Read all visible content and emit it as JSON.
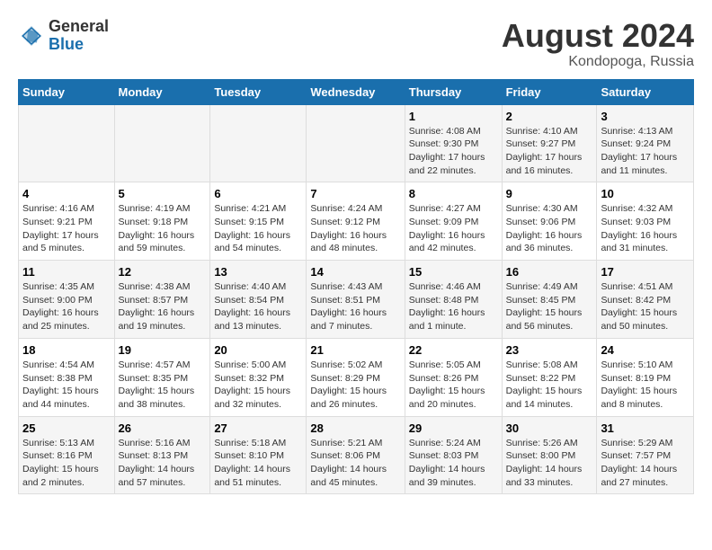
{
  "logo": {
    "general": "General",
    "blue": "Blue"
  },
  "title": {
    "month_year": "August 2024",
    "location": "Kondopoga, Russia"
  },
  "weekdays": [
    "Sunday",
    "Monday",
    "Tuesday",
    "Wednesday",
    "Thursday",
    "Friday",
    "Saturday"
  ],
  "weeks": [
    [
      {
        "day": "",
        "info": ""
      },
      {
        "day": "",
        "info": ""
      },
      {
        "day": "",
        "info": ""
      },
      {
        "day": "",
        "info": ""
      },
      {
        "day": "1",
        "info": "Sunrise: 4:08 AM\nSunset: 9:30 PM\nDaylight: 17 hours\nand 22 minutes."
      },
      {
        "day": "2",
        "info": "Sunrise: 4:10 AM\nSunset: 9:27 PM\nDaylight: 17 hours\nand 16 minutes."
      },
      {
        "day": "3",
        "info": "Sunrise: 4:13 AM\nSunset: 9:24 PM\nDaylight: 17 hours\nand 11 minutes."
      }
    ],
    [
      {
        "day": "4",
        "info": "Sunrise: 4:16 AM\nSunset: 9:21 PM\nDaylight: 17 hours\nand 5 minutes."
      },
      {
        "day": "5",
        "info": "Sunrise: 4:19 AM\nSunset: 9:18 PM\nDaylight: 16 hours\nand 59 minutes."
      },
      {
        "day": "6",
        "info": "Sunrise: 4:21 AM\nSunset: 9:15 PM\nDaylight: 16 hours\nand 54 minutes."
      },
      {
        "day": "7",
        "info": "Sunrise: 4:24 AM\nSunset: 9:12 PM\nDaylight: 16 hours\nand 48 minutes."
      },
      {
        "day": "8",
        "info": "Sunrise: 4:27 AM\nSunset: 9:09 PM\nDaylight: 16 hours\nand 42 minutes."
      },
      {
        "day": "9",
        "info": "Sunrise: 4:30 AM\nSunset: 9:06 PM\nDaylight: 16 hours\nand 36 minutes."
      },
      {
        "day": "10",
        "info": "Sunrise: 4:32 AM\nSunset: 9:03 PM\nDaylight: 16 hours\nand 31 minutes."
      }
    ],
    [
      {
        "day": "11",
        "info": "Sunrise: 4:35 AM\nSunset: 9:00 PM\nDaylight: 16 hours\nand 25 minutes."
      },
      {
        "day": "12",
        "info": "Sunrise: 4:38 AM\nSunset: 8:57 PM\nDaylight: 16 hours\nand 19 minutes."
      },
      {
        "day": "13",
        "info": "Sunrise: 4:40 AM\nSunset: 8:54 PM\nDaylight: 16 hours\nand 13 minutes."
      },
      {
        "day": "14",
        "info": "Sunrise: 4:43 AM\nSunset: 8:51 PM\nDaylight: 16 hours\nand 7 minutes."
      },
      {
        "day": "15",
        "info": "Sunrise: 4:46 AM\nSunset: 8:48 PM\nDaylight: 16 hours\nand 1 minute."
      },
      {
        "day": "16",
        "info": "Sunrise: 4:49 AM\nSunset: 8:45 PM\nDaylight: 15 hours\nand 56 minutes."
      },
      {
        "day": "17",
        "info": "Sunrise: 4:51 AM\nSunset: 8:42 PM\nDaylight: 15 hours\nand 50 minutes."
      }
    ],
    [
      {
        "day": "18",
        "info": "Sunrise: 4:54 AM\nSunset: 8:38 PM\nDaylight: 15 hours\nand 44 minutes."
      },
      {
        "day": "19",
        "info": "Sunrise: 4:57 AM\nSunset: 8:35 PM\nDaylight: 15 hours\nand 38 minutes."
      },
      {
        "day": "20",
        "info": "Sunrise: 5:00 AM\nSunset: 8:32 PM\nDaylight: 15 hours\nand 32 minutes."
      },
      {
        "day": "21",
        "info": "Sunrise: 5:02 AM\nSunset: 8:29 PM\nDaylight: 15 hours\nand 26 minutes."
      },
      {
        "day": "22",
        "info": "Sunrise: 5:05 AM\nSunset: 8:26 PM\nDaylight: 15 hours\nand 20 minutes."
      },
      {
        "day": "23",
        "info": "Sunrise: 5:08 AM\nSunset: 8:22 PM\nDaylight: 15 hours\nand 14 minutes."
      },
      {
        "day": "24",
        "info": "Sunrise: 5:10 AM\nSunset: 8:19 PM\nDaylight: 15 hours\nand 8 minutes."
      }
    ],
    [
      {
        "day": "25",
        "info": "Sunrise: 5:13 AM\nSunset: 8:16 PM\nDaylight: 15 hours\nand 2 minutes."
      },
      {
        "day": "26",
        "info": "Sunrise: 5:16 AM\nSunset: 8:13 PM\nDaylight: 14 hours\nand 57 minutes."
      },
      {
        "day": "27",
        "info": "Sunrise: 5:18 AM\nSunset: 8:10 PM\nDaylight: 14 hours\nand 51 minutes."
      },
      {
        "day": "28",
        "info": "Sunrise: 5:21 AM\nSunset: 8:06 PM\nDaylight: 14 hours\nand 45 minutes."
      },
      {
        "day": "29",
        "info": "Sunrise: 5:24 AM\nSunset: 8:03 PM\nDaylight: 14 hours\nand 39 minutes."
      },
      {
        "day": "30",
        "info": "Sunrise: 5:26 AM\nSunset: 8:00 PM\nDaylight: 14 hours\nand 33 minutes."
      },
      {
        "day": "31",
        "info": "Sunrise: 5:29 AM\nSunset: 7:57 PM\nDaylight: 14 hours\nand 27 minutes."
      }
    ]
  ]
}
